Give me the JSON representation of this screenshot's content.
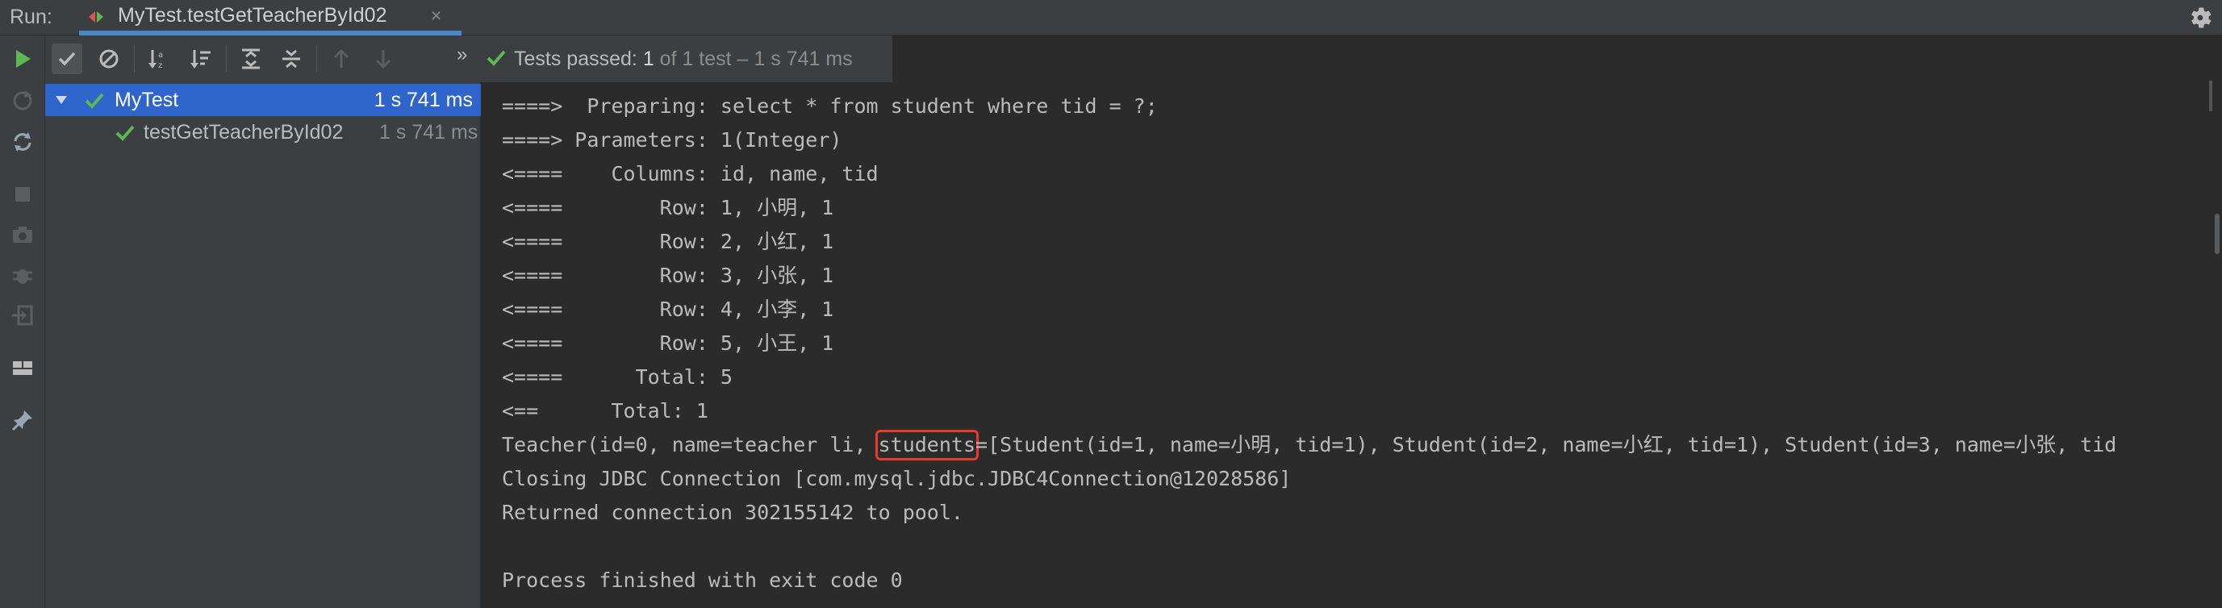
{
  "header": {
    "run_label": "Run:",
    "tab_title": "MyTest.testGetTeacherById02",
    "tab_close": "×",
    "settings_icon": "gear-icon"
  },
  "toolbar": {
    "more_label": "»",
    "status": {
      "passed_label": "Tests passed: ",
      "passed_count": "1",
      "detail": " of 1 test – 1 s 741 ms"
    }
  },
  "tree": {
    "items": [
      {
        "name": "MyTest",
        "time": "1 s 741 ms",
        "state": "passed",
        "selected": true
      },
      {
        "name": "testGetTeacherById02",
        "time": "1 s 741 ms",
        "state": "passed",
        "selected": false
      }
    ]
  },
  "console": {
    "lines": [
      "====>  Preparing: select * from student where tid = ?;",
      "====> Parameters: 1(Integer)",
      "<====    Columns: id, name, tid",
      "<====        Row: 1, 小明, 1",
      "<====        Row: 2, 小红, 1",
      "<====        Row: 3, 小张, 1",
      "<====        Row: 4, 小李, 1",
      "<====        Row: 5, 小王, 1",
      "<====      Total: 5",
      "<==      Total: 1"
    ],
    "teacher_line": {
      "before": "Teacher(id=0, name=teacher li, ",
      "highlight": "students",
      "after": "=[Student(id=1, name=小明, tid=1), Student(id=2, name=小红, tid=1), Student(id=3, name=小张, tid"
    },
    "after_lines": [
      "Closing JDBC Connection [com.mysql.jdbc.JDBC4Connection@12028586]",
      "Returned connection 302155142 to pool.",
      "",
      "Process finished with exit code 0"
    ]
  },
  "colors": {
    "background": "#2b2b2b",
    "panel": "#3c3f41",
    "accent_tab": "#4a88c7",
    "selection": "#2f65ca",
    "pass_green": "#5fb653",
    "highlight_box": "#e53c2f"
  }
}
